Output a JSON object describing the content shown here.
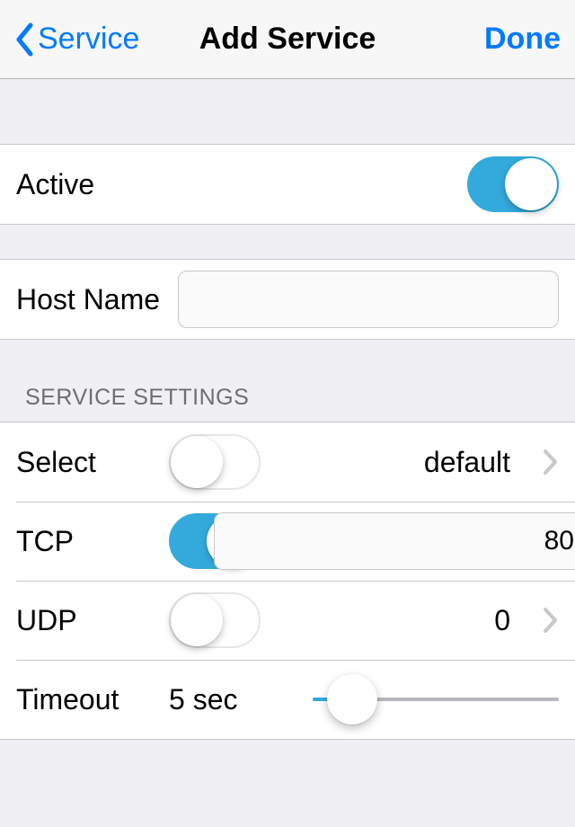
{
  "nav": {
    "back_label": "Service",
    "title": "Add Service",
    "done_label": "Done"
  },
  "rows": {
    "active_label": "Active",
    "active_on": true,
    "hostname_label": "Host Name",
    "hostname_value": ""
  },
  "section_header": "SERVICE SETTINGS",
  "settings": {
    "select_label": "Select",
    "select_on": false,
    "select_value": "default",
    "tcp_label": "TCP",
    "tcp_on": true,
    "tcp_port": "80",
    "udp_label": "UDP",
    "udp_on": false,
    "udp_value": "0",
    "timeout_label": "Timeout",
    "timeout_value": "5 sec",
    "timeout_slider_percent": 16
  },
  "colors": {
    "accent": "#007aff",
    "switch_on": "#34aadc"
  }
}
